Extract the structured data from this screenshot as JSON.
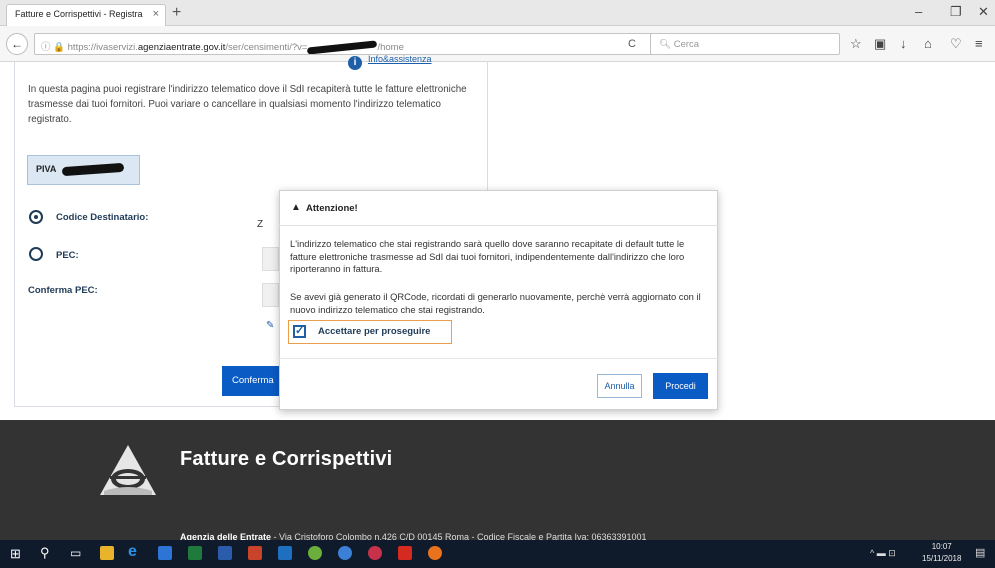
{
  "browser": {
    "tab_title": "Fatture e Corrispettivi - Registra",
    "url_prefix": "https://ivaservizi.",
    "url_domain": "agenziaentrate.gov.it",
    "url_path": "/ser/censimenti/?v=",
    "url_suffix": "/home",
    "search_placeholder": "Cerca"
  },
  "page": {
    "info_link": "Info&assistenza",
    "intro_text": "In questa pagina puoi registrare l'indirizzo telematico dove il SdI recapiterà tutte le fatture elettroniche trasmesse dai tuoi fornitori. Puoi variare o cancellare in qualsiasi momento l'indirizzo telematico registrato.",
    "piva_label": "PIVA",
    "codice_destinatario_label": "Codice Destinatario:",
    "codice_value_prefix": "Z",
    "pec_label": "PEC:",
    "conferma_pec_label": "Conferma PEC:",
    "confirm_button": "Conferma"
  },
  "modal": {
    "title": "Attenzione!",
    "paragraph1": "L'indirizzo telematico che stai registrando sarà quello dove saranno recapitate di default tutte le fatture elettroniche trasmesse ad SdI dai tuoi fornitori, indipendentemente dall'indirizzo che loro riporteranno in fattura.",
    "paragraph2": "Se avevi già generato il QRCode, ricordati di generarlo nuovamente, perchè verrà aggiornato con il nuovo indirizzo telematico che stai registrando.",
    "accept_label": "Accettare per proseguire",
    "accept_checked": true,
    "cancel_button": "Annulla",
    "proceed_button": "Procedi"
  },
  "footer": {
    "title": "Fatture e Corrispettivi",
    "org": "Agenzia delle Entrate",
    "address": " - Via Cristoforo Colombo n.426 C/D 00145 Roma - Codice Fiscale e Partita Iva: 06363391001"
  },
  "taskbar": {
    "time": "10:07",
    "date": "15/11/2018"
  },
  "colors": {
    "primary": "#0a5bc4",
    "footer_bg": "#333333",
    "accept_border": "#e8a04c"
  }
}
